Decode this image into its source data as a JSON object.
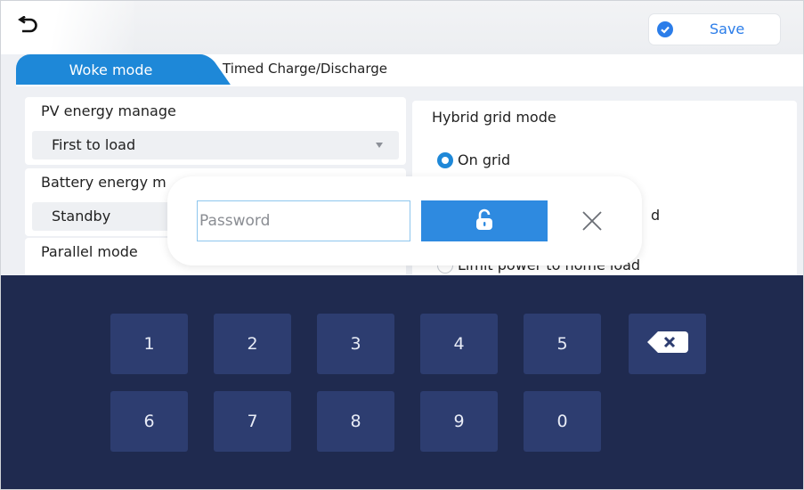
{
  "header": {
    "back_icon": "back-arrow-icon",
    "save_label": "Save",
    "save_icon": "check-circle-icon",
    "accent_color": "#2b7de9"
  },
  "tabs": [
    {
      "label": "Woke mode",
      "active": true
    },
    {
      "label": "Timed Charge/Discharge",
      "active": false
    }
  ],
  "pv": {
    "title": "PV energy manage",
    "value": "First to load"
  },
  "battery": {
    "title": "Battery energy m",
    "value": "Standby"
  },
  "parallel": {
    "title": "Parallel mode"
  },
  "hybrid": {
    "title": "Hybrid grid mode",
    "options": [
      {
        "label": "On grid",
        "selected": true
      },
      {
        "label": "d",
        "selected": false
      },
      {
        "label": "Limit power to home load",
        "selected": false
      }
    ]
  },
  "dialog": {
    "placeholder": "Password",
    "value": "",
    "unlock_icon": "unlock-icon",
    "close_icon": "close-icon"
  },
  "keypad": {
    "row1": [
      "1",
      "2",
      "3",
      "4",
      "5"
    ],
    "row2": [
      "6",
      "7",
      "8",
      "9",
      "0"
    ],
    "backspace_icon": "backspace-icon",
    "bg_color": "#1f2a4f",
    "key_color": "#2d3d70"
  }
}
